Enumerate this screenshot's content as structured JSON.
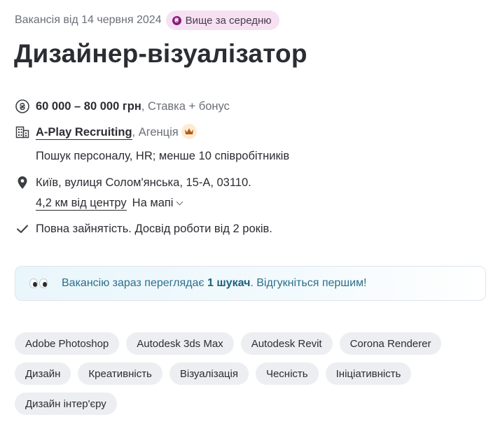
{
  "header": {
    "posted": "Вакансія від 14 червня 2024",
    "badge_icon": "₴",
    "badge_label": "Вище за середню"
  },
  "title": "Дизайнер-візуалізатор",
  "salary": {
    "icon": "hryvnia-icon",
    "amount": "60 000 – 80 000 грн",
    "note": ", Ставка + бонус"
  },
  "company": {
    "icon": "building-icon",
    "name": "A-Play Recruiting",
    "type": ", Агенція",
    "crown_icon": "crown-icon",
    "description": "Пошук персоналу, HR; менше 10 співробітників"
  },
  "location": {
    "icon": "map-pin-icon",
    "address": "Київ, вулиця Солом'янська, 15-А, 03110.",
    "distance": "4,2 км від центру",
    "map_label": "На мапі"
  },
  "employment": {
    "icon": "check-icon",
    "text": "Повна зайнятість. Досвід роботи від 2 років."
  },
  "notice": {
    "icon": "eyes-icon",
    "prefix": "Вакансію зараз переглядає ",
    "count": "1 шукач",
    "suffix": ". Відгукніться першим!"
  },
  "tags": [
    "Adobe Photoshop",
    "Autodesk 3ds Max",
    "Autodesk Revit",
    "Corona Renderer",
    "Дизайн",
    "Креативність",
    "Візуалізація",
    "Чесність",
    "Ініціативність",
    "Дизайн інтер'єру"
  ],
  "colors": {
    "badge_bg": "#f6e1f3",
    "badge_icon": "#8a1c7c",
    "notice_text": "#2b6f8a",
    "tag_bg": "#eceef1"
  }
}
